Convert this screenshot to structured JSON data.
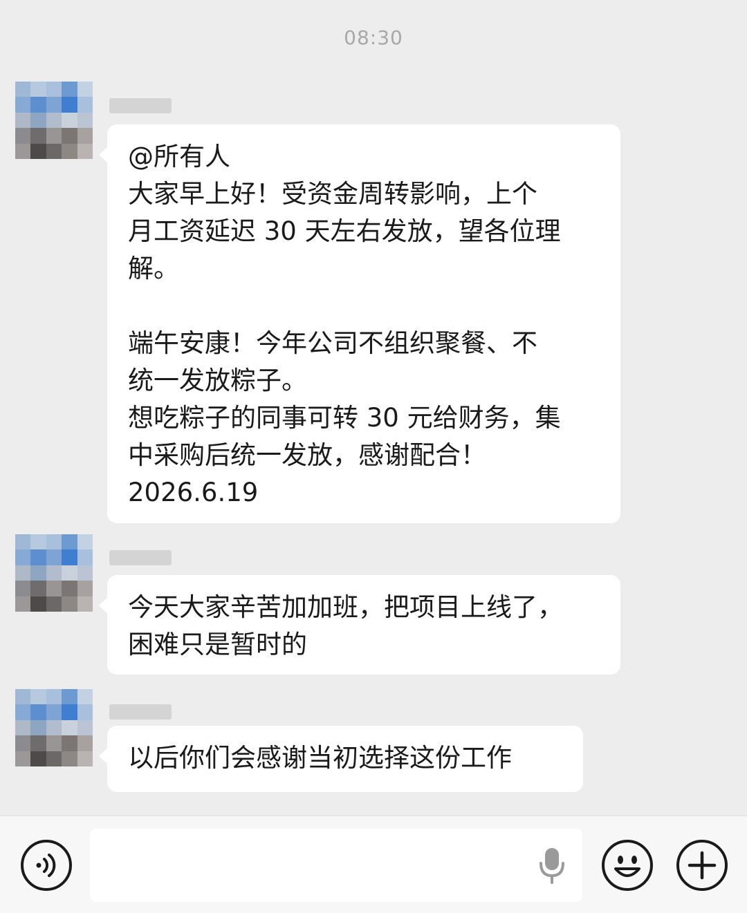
{
  "chat": {
    "timestamp": "08:30",
    "messages": [
      {
        "id": "msg-1",
        "paragraphs": [
          "@所有人",
          "大家早上好！受资金周转影响，上个\n月工资延迟 30 天左右发放，望各位理\n解。",
          "",
          "端午安康！今年公司不组织聚餐、不\n统一发放粽子。",
          "想吃粽子的同事可转 30 元给财务，集\n中采购后统一发放，感谢配合！",
          "2026.6.19"
        ]
      },
      {
        "id": "msg-2",
        "text": "今天大家辛苦加加班，把项目上线了，\n困难只是暂时的"
      },
      {
        "id": "msg-3",
        "text": "以后你们会感谢当初选择这份工作"
      }
    ]
  },
  "input_bar": {
    "voice_icon": "voice-icon",
    "mic_icon": "microphone-icon",
    "emoji_icon": "emoji-icon",
    "plus_icon": "plus-icon"
  },
  "colors": {
    "background": "#ededed",
    "bubble": "#ffffff",
    "timestamp": "#a8a8a8"
  }
}
